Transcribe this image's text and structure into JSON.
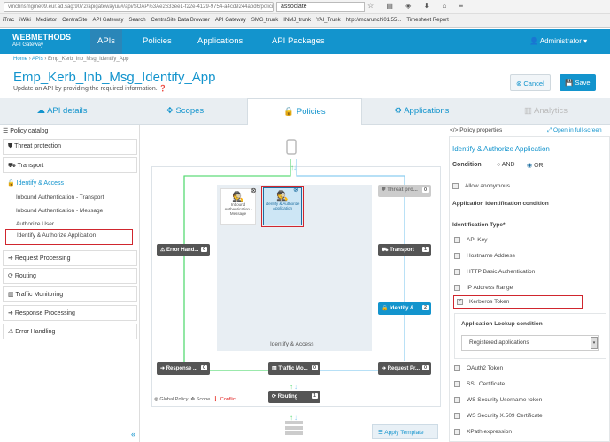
{
  "browser": {
    "url": "vmchnsmgme09.eur.ad.sag:9072/apigatewayui/#/api/SOAP%3Ae2633ee1-f22e-4129-9754-a4cd9244abd6/policies",
    "search": "associate",
    "bookmarks": [
      "iTrac",
      "iWiki",
      "Mediator",
      "CentraSite",
      "API Gateway",
      "Search",
      "CentraSite Data Browser",
      "API Gateway",
      "SMG_trunk",
      "INMJ_trunk",
      "YAI_Trunk",
      "http://mcarunchi01:55...",
      "Timesheet Report"
    ]
  },
  "header": {
    "brand": "WEBMETHODS",
    "brand_sub": "API Gateway",
    "nav": [
      "APIs",
      "Policies",
      "Applications",
      "API Packages"
    ],
    "user": "Administrator"
  },
  "breadcrumb": [
    "Home",
    "APIs",
    "Emp_Kerb_Inb_Msg_Identify_App"
  ],
  "page": {
    "title": "Emp_Kerb_Inb_Msg_Identify_App",
    "subtitle": "Update an API by providing the required information.",
    "cancel": "Cancel",
    "save": "Save"
  },
  "tabs": [
    "API details",
    "Scopes",
    "Policies",
    "Applications",
    "Analytics"
  ],
  "catalog": {
    "title": "Policy catalog",
    "items": [
      "Threat protection",
      "Transport",
      "Identify & Access",
      "Request Processing",
      "Routing",
      "Traffic Monitoring",
      "Response Processing",
      "Error Handling"
    ],
    "sub_items": [
      "Inbound Authentication - Transport",
      "Inbound Authentication - Message",
      "Authorize User",
      "Identify & Authorize Application"
    ]
  },
  "flow": {
    "nodes": {
      "threat": {
        "label": "Threat pro...",
        "count": "0"
      },
      "transport": {
        "label": "Transport",
        "count": "1"
      },
      "identify": {
        "label": "Identify & ...",
        "count": "2"
      },
      "request": {
        "label": "Request Pr...",
        "count": "0"
      },
      "traffic": {
        "label": "Traffic Mo...",
        "count": "0"
      },
      "response": {
        "label": "Response ...",
        "count": "0"
      },
      "error": {
        "label": "Error Hand...",
        "count": "0"
      },
      "routing": {
        "label": "Routing",
        "count": "1"
      }
    },
    "stage_label": "Identify & Access",
    "card1": "Inbound Authentication - Message",
    "card2": "Identify & Authorize Application",
    "legend": [
      "Global Policy",
      "Scope",
      "Conflict"
    ],
    "apply_template": "Apply Template"
  },
  "props": {
    "title": "Policy properties",
    "fullscreen": "Open in full-screen",
    "policy_name": "Identify & Authorize Application",
    "condition_label": "Condition",
    "and": "AND",
    "or": "OR",
    "allow_anon": "Allow anonymous",
    "app_id_cond": "Application Identification condition",
    "id_type": "Identification Type*",
    "types": [
      "API Key",
      "Hostname Address",
      "HTTP Basic Authentication",
      "IP Address Range",
      "Kerberos Token"
    ],
    "lookup_label": "Application Lookup condition",
    "lookup_value": "Registered applications",
    "types2": [
      "OAuth2 Token",
      "SSL Certificate",
      "WS Security Username token",
      "WS Security X.509 Certificate",
      "XPath expression"
    ]
  }
}
